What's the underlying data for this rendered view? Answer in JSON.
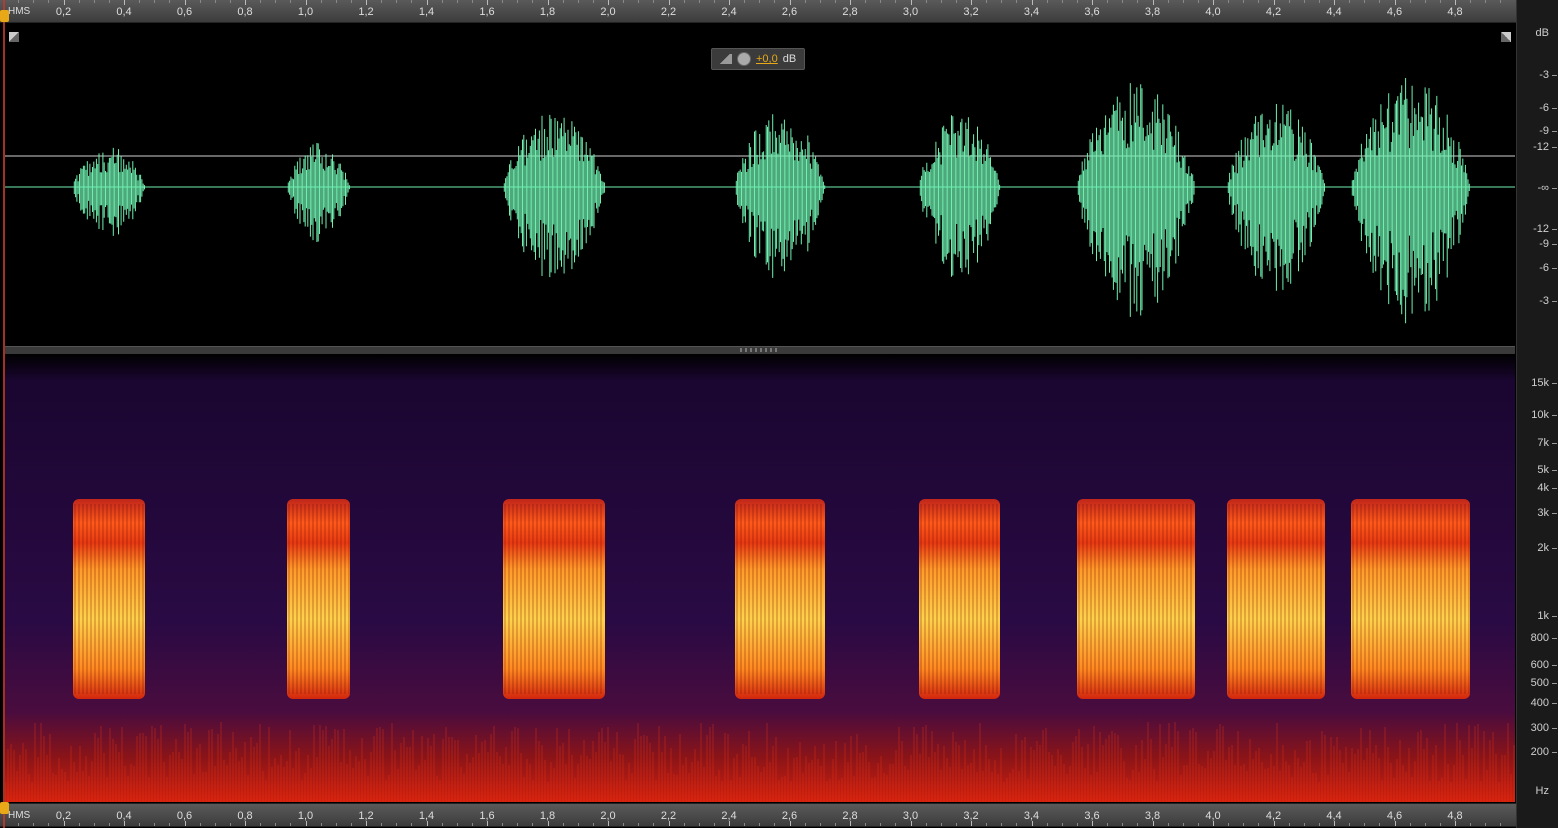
{
  "time_ruler": {
    "unit": "HMS",
    "labels": [
      "0,2",
      "0,4",
      "0,6",
      "0,8",
      "1,0",
      "1,2",
      "1,4",
      "1,6",
      "1,8",
      "2,0",
      "2,2",
      "2,4",
      "2,6",
      "2,8",
      "3,0",
      "3,2",
      "3,4",
      "3,6",
      "3,8",
      "4,0",
      "4,2",
      "4,4",
      "4,6",
      "4,8"
    ]
  },
  "waveform": {
    "color": "#6ff0b0",
    "amplitude_scale_unit": "dB",
    "amplitude_scale_labels": [
      "-3",
      "-6",
      "-9",
      "-12",
      "-∞",
      "-12",
      "-9",
      "-6",
      "-3"
    ]
  },
  "spectral": {
    "frequency_scale_unit": "Hz",
    "frequency_scale_labels": [
      "15k",
      "10k",
      "7k",
      "5k",
      "4k",
      "3k",
      "2k",
      "1k",
      "800",
      "600",
      "500",
      "400",
      "300",
      "200"
    ]
  },
  "hud": {
    "volume_value": "+0,0",
    "volume_unit": "dB"
  }
}
